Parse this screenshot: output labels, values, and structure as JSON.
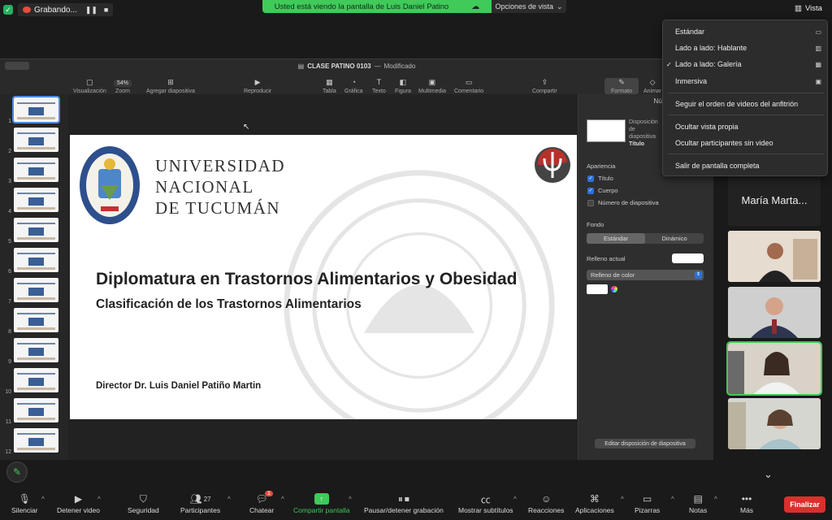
{
  "topbar": {
    "recording_label": "Grabando...",
    "share_banner": "Usted está viendo la pantalla de Luis Daniel Patino",
    "view_options": "Opciones de vista",
    "vista": "Vista"
  },
  "keynote": {
    "document_title": "CLASE PATINO 0103",
    "document_status": "Modificado",
    "zoom": "54%",
    "toolbar": {
      "visualizacion": "Visualización",
      "zoom": "Zoom",
      "agregar": "Agregar diapositiva",
      "reproducir": "Reproducir",
      "tabla": "Tabla",
      "grafica": "Gráfica",
      "texto": "Texto",
      "figura": "Figura",
      "multimedia": "Multimedia",
      "comentario": "Comentario",
      "compartir": "Compartir",
      "formato": "Formato",
      "animar": "Animar"
    },
    "thumbnails": [
      "1",
      "2",
      "3",
      "4",
      "5",
      "6",
      "7",
      "8",
      "9",
      "10",
      "11",
      "12"
    ],
    "slide": {
      "university": [
        "UNIVERSIDAD",
        "NACIONAL",
        "DE TUCUMÁN"
      ],
      "title": "Diplomatura en Trastornos Alimentarios y Obesidad",
      "subtitle": "Clasificación de los Trastornos Alimentarios",
      "director": "Director Dr. Luis Daniel Patiño Martin"
    },
    "inspector": {
      "tab": "Número",
      "layout_label": "Disposición de diapositiva",
      "layout_name": "Título",
      "appearance": "Apariencia",
      "chk_title": "Título",
      "chk_body": "Cuerpo",
      "chk_number": "Número de diapositiva",
      "background": "Fondo",
      "seg_standard": "Estándar",
      "seg_dynamic": "Dinámico",
      "current_fill": "Relleno actual",
      "fill_type": "Relleno de color",
      "edit_layout": "Editar disposición de diapositiva"
    }
  },
  "menu": {
    "items": [
      {
        "label": "Estándar",
        "checked": false,
        "icon": "standard-icon"
      },
      {
        "label": "Lado a lado: Hablante",
        "checked": false,
        "icon": "speaker-icon"
      },
      {
        "label": "Lado a lado: Galería",
        "checked": true,
        "icon": "gallery-icon"
      },
      {
        "label": "Inmersiva",
        "checked": false,
        "icon": "immersive-icon"
      },
      {
        "label": "Seguir el orden de videos del anfitrión",
        "checked": false
      },
      {
        "label": "Ocultar vista propia",
        "checked": false
      },
      {
        "label": "Ocultar participantes sin video",
        "checked": false
      },
      {
        "label": "Salir de pantalla completa",
        "checked": false
      }
    ]
  },
  "gallery": {
    "named_tile": "María Marta..."
  },
  "bottombar": {
    "silenciar": "Silenciar",
    "detener_video": "Detener video",
    "seguridad": "Seguridad",
    "participantes": "Participantes",
    "participant_count": "27",
    "chatear": "Chatear",
    "chat_badge": "1",
    "compartir_pantalla": "Compartir pantalla",
    "pausar": "Pausar/detener grabación",
    "subtitulos": "Mostrar subtítulos",
    "reacciones": "Reacciones",
    "aplicaciones": "Aplicaciones",
    "pizarras": "Pizarras",
    "notas": "Notas",
    "mas": "Más",
    "finalizar": "Finalizar"
  },
  "colors": {
    "zoom_green": "#3fca5a",
    "end_red": "#d9302c",
    "selection_blue": "#2f6fd8"
  }
}
